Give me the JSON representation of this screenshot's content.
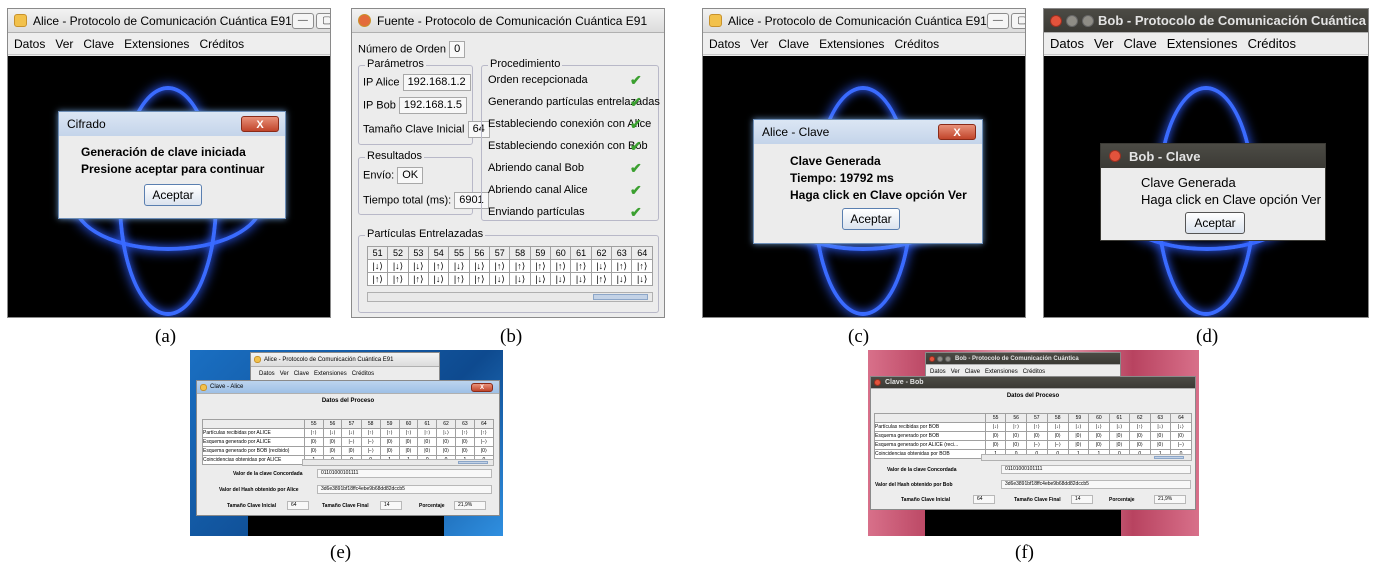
{
  "panel_a": {
    "title": "Alice - Protocolo de Comunicación Cuántica E91",
    "menu": [
      "Datos",
      "Ver",
      "Clave",
      "Extensiones",
      "Créditos"
    ],
    "dialog": {
      "title": "Cifrado",
      "lines": [
        "Generación de clave iniciada",
        "Presione aceptar para continuar"
      ],
      "button": "Aceptar"
    },
    "caption": "(a)"
  },
  "panel_b": {
    "title": "Fuente - Protocolo de Comunicación Cuántica E91",
    "orden_label": "Número de Orden",
    "orden_value": "0",
    "parametros_label": "Parámetros",
    "ip_alice_label": "IP Alice",
    "ip_alice": "192.168.1.2",
    "ip_bob_label": "IP Bob",
    "ip_bob": "192.168.1.5",
    "tam_label": "Tamaño Clave Inicial",
    "tam_value": "64",
    "resultados_label": "Resultados",
    "envio_label": "Envío:",
    "envio_value": "OK",
    "tiempo_label": "Tiempo total (ms):",
    "tiempo_value": "6901",
    "proc_label": "Procedimiento",
    "proc_steps": [
      "Orden recepcionada",
      "Generando partículas entrelazadas",
      "Estableciendo conexión con Alice",
      "Estableciendo conexión con Bob",
      "Abriendo canal Bob",
      "Abriendo canal Alice",
      "Enviando partículas"
    ],
    "check": "✔",
    "particulas_label": "Partículas Entrelazadas",
    "cols": [
      "51",
      "52",
      "53",
      "54",
      "55",
      "56",
      "57",
      "58",
      "59",
      "60",
      "61",
      "62",
      "63",
      "64"
    ],
    "row1": [
      "|↓⟩",
      "|↓⟩",
      "|↓⟩",
      "|↑⟩",
      "|↓⟩",
      "|↓⟩",
      "|↑⟩",
      "|↑⟩",
      "|↑⟩",
      "|↑⟩",
      "|↑⟩",
      "|↓⟩",
      "|↑⟩",
      "|↑⟩"
    ],
    "row2": [
      "|↑⟩",
      "|↑⟩",
      "|↑⟩",
      "|↓⟩",
      "|↑⟩",
      "|↑⟩",
      "|↓⟩",
      "|↓⟩",
      "|↓⟩",
      "|↓⟩",
      "|↓⟩",
      "|↑⟩",
      "|↓⟩",
      "|↓⟩"
    ],
    "caption": "(b)"
  },
  "panel_c": {
    "title": "Alice - Protocolo de Comunicación Cuántica E91",
    "menu": [
      "Datos",
      "Ver",
      "Clave",
      "Extensiones",
      "Créditos"
    ],
    "dialog": {
      "title": "Alice - Clave",
      "lines": [
        "Clave Generada",
        "Tiempo: 19792 ms",
        "Haga click en Clave opción Ver"
      ],
      "button": "Aceptar"
    },
    "caption": "(c)"
  },
  "panel_d": {
    "title": "Bob - Protocolo de Comunicación Cuántica",
    "menu": [
      "Datos",
      "Ver",
      "Clave",
      "Extensiones",
      "Créditos"
    ],
    "dialog": {
      "title": "Bob - Clave",
      "lines": [
        "Clave Generada",
        "Haga click en Clave opción Ver"
      ],
      "button": "Aceptar"
    },
    "caption": "(d)"
  },
  "panel_e": {
    "back_title": "Alice - Protocolo de Comunicación Cuántica E91",
    "menu": [
      "Datos",
      "Ver",
      "Clave",
      "Extensiones",
      "Créditos"
    ],
    "title": "Clave - Alice",
    "heading": "Datos del Proceso",
    "cols": [
      "55",
      "56",
      "57",
      "58",
      "59",
      "60",
      "61",
      "62",
      "63",
      "64"
    ],
    "rows": [
      {
        "label": "Partículas recibidas por ALICE",
        "cells": [
          "|↑⟩",
          "|↓⟩",
          "|↓⟩",
          "|↑⟩",
          "|↑⟩",
          "|↑⟩",
          "|↑⟩",
          "|↓⟩",
          "|↑⟩",
          "|↑⟩"
        ]
      },
      {
        "label": "Esquema generado por ALICE",
        "cells": [
          "|0⟩",
          "|0⟩",
          "|−⟩",
          "|−⟩",
          "|0⟩",
          "|0⟩",
          "|0⟩",
          "|0⟩",
          "|0⟩",
          "|−⟩"
        ]
      },
      {
        "label": "Esquema generado por BOB (recibido)",
        "cells": [
          "|0⟩",
          "|0⟩",
          "|0⟩",
          "|−⟩",
          "|0⟩",
          "|0⟩",
          "|0⟩",
          "|0⟩",
          "|0⟩",
          "|0⟩"
        ]
      },
      {
        "label": "Coincidencias obtenidas por ALICE",
        "cells": [
          "1",
          "0",
          "0",
          "0",
          "1",
          "1",
          "0",
          "0",
          "1",
          "0"
        ]
      }
    ],
    "valor_label": "Valor de la clave Concordada",
    "valor": "01101000101111",
    "hash_label": "Valor del Hash obtenido por Alice",
    "hash": "3d6e3891bf18ffc4ebe9b68dd82dccb5",
    "ini_label": "Tamaño Clave Inicial",
    "ini": "64",
    "fin_label": "Tamaño Clave Final",
    "fin": "14",
    "pct_label": "Porcentaje",
    "pct": "21,9%",
    "caption": "(e)"
  },
  "panel_f": {
    "back_title": "Bob - Protocolo de Comunicación Cuántica",
    "menu": [
      "Datos",
      "Ver",
      "Clave",
      "Extensiones",
      "Créditos"
    ],
    "title": "Clave - Bob",
    "heading": "Datos del Proceso",
    "cols": [
      "55",
      "56",
      "57",
      "58",
      "59",
      "60",
      "61",
      "62",
      "63",
      "64"
    ],
    "rows": [
      {
        "label": "Partículas recibidas por BOB",
        "cells": [
          "|↓⟩",
          "|↑⟩",
          "|↑⟩",
          "|↓⟩",
          "|↓⟩",
          "|↓⟩",
          "|↓⟩",
          "|↑⟩",
          "|↓⟩",
          "|↓⟩"
        ]
      },
      {
        "label": "Esquema generado por BOB",
        "cells": [
          "|0⟩",
          "|0⟩",
          "|0⟩",
          "|0⟩",
          "|0⟩",
          "|0⟩",
          "|0⟩",
          "|0⟩",
          "|0⟩",
          "|0⟩"
        ]
      },
      {
        "label": "Esquema generado por ALICE (reci...",
        "cells": [
          "|0⟩",
          "|0⟩",
          "|−⟩",
          "|−⟩",
          "|0⟩",
          "|0⟩",
          "|0⟩",
          "|0⟩",
          "|0⟩",
          "|−⟩"
        ]
      },
      {
        "label": "Coincidencias obtenidas por BOB",
        "cells": [
          "1",
          "0",
          "0",
          "0",
          "1",
          "1",
          "0",
          "0",
          "1",
          "0"
        ]
      }
    ],
    "valor_label": "Valor de la clave Concordada",
    "valor": "01101000101111",
    "hash_label": "Valor del Hash obtenido por Bob",
    "hash": "3d6e3891bf18ffc4ebe9b68dd82dccb5",
    "ini_label": "Tamaño Clave Inicial",
    "ini": "64",
    "fin_label": "Tamaño Clave Final",
    "fin": "14",
    "pct_label": "Porcentaje",
    "pct": "21,9%",
    "caption": "(f)"
  }
}
